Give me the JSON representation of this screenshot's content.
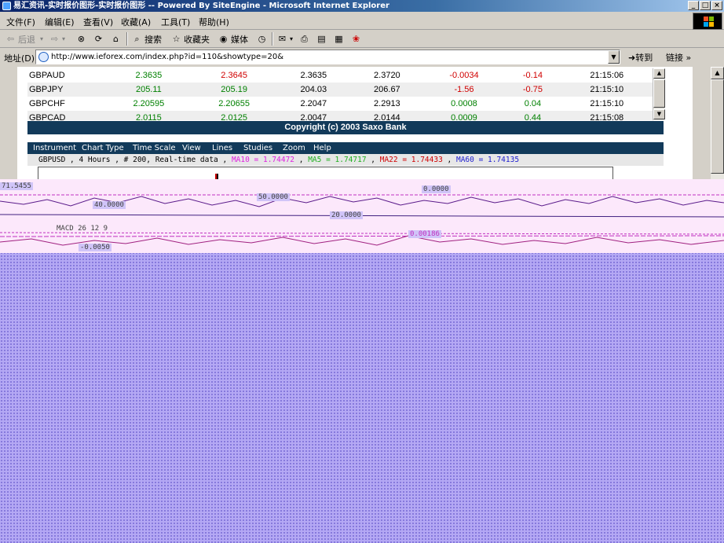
{
  "window": {
    "title": "易汇资讯-实时报价图形-实时报价图形 -- Powered By SiteEngine - Microsoft Internet Explorer",
    "buttons": [
      "_",
      "□",
      "×"
    ]
  },
  "menubar": {
    "items": [
      "文件(F)",
      "编辑(E)",
      "查看(V)",
      "收藏(A)",
      "工具(T)",
      "帮助(H)"
    ]
  },
  "toolbar": {
    "back_label": "后退",
    "search_label": "搜索",
    "favorites_label": "收藏夹",
    "media_label": "媒体"
  },
  "address": {
    "label": "地址(D)",
    "url": "http://www.ieforex.com/index.php?id=110&showtype=20&",
    "go_label": "转到",
    "links_label": "链接"
  },
  "quotes": {
    "rows": [
      {
        "symbol": "GBPAUD",
        "bid": "2.3635",
        "ask": "2.3645",
        "low": "2.3635",
        "high": "2.3720",
        "change": "-0.0034",
        "pct": "-0.14",
        "time": "21:15:06",
        "bid_color": "green",
        "ask_color": "red",
        "change_color": "red"
      },
      {
        "symbol": "GBPJPY",
        "bid": "205.11",
        "ask": "205.19",
        "low": "204.03",
        "high": "206.67",
        "change": "-1.56",
        "pct": "-0.75",
        "time": "21:15:10",
        "bid_color": "green",
        "ask_color": "green",
        "change_color": "red"
      },
      {
        "symbol": "GBPCHF",
        "bid": "2.20595",
        "ask": "2.20655",
        "low": "2.2047",
        "high": "2.2913",
        "change": "0.0008",
        "pct": "0.04",
        "time": "21:15:10",
        "bid_color": "green",
        "ask_color": "green",
        "change_color": "green"
      },
      {
        "symbol": "GBPCAD",
        "bid": "2.0115",
        "ask": "2.0125",
        "low": "2.0047",
        "high": "2.0144",
        "change": "0.0009",
        "pct": "0.44",
        "time": "21:15:08",
        "bid_color": "green",
        "ask_color": "green",
        "change_color": "green"
      }
    ]
  },
  "copyright": "Copyright (c) 2003 Saxo Bank",
  "chart_menu": [
    "Instrument",
    "Chart Type",
    "Time Scale",
    "View",
    "Lines",
    "Studies",
    "Zoom",
    "Help"
  ],
  "chart_info": {
    "prefix": "GBPUSD , 4 Hours , # 200, Real-time data , ",
    "ma10": "MA10 = 1.74472",
    "ma5": "MA5 = 1.74717",
    "ma22": "MA22 = 1.74433",
    "ma60": "MA60 = 1.74135",
    "sep": " , "
  },
  "glitch_labels": [
    "71.5455",
    "50.0000",
    "40.0000",
    "20.0000",
    "MACD 26 12 9",
    "0.00186",
    "-0.0050",
    "0.0000"
  ],
  "colors": {
    "header_navy": "#123a5a",
    "green": "#008000",
    "red": "#d00000",
    "glitch_purple": "#b4a8f4",
    "glitch_pink": "#fce8fb"
  }
}
